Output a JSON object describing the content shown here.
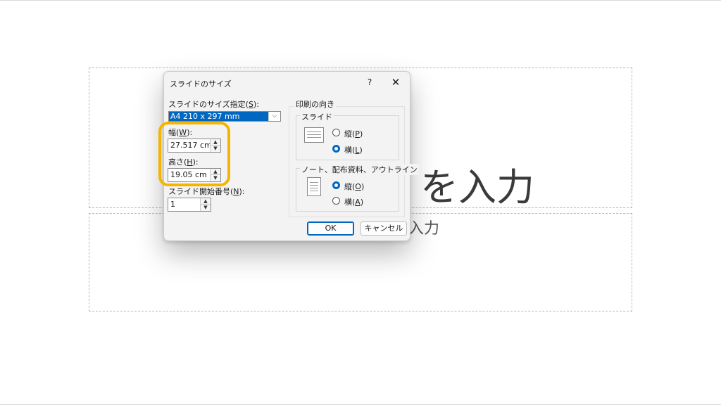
{
  "slide": {
    "title_placeholder": "を入力",
    "subtitle_placeholder": "入力"
  },
  "dialog": {
    "title": "スライドのサイズ",
    "help": "?",
    "close": "✕",
    "size_label": "スライドのサイズ指定(S):",
    "size_label_main": "スライドのサイズ指定(",
    "size_label_key": "S",
    "size_label_end": "):",
    "size_value": "A4 210 x 297 mm",
    "width_label_main": "幅(",
    "width_label_key": "W",
    "width_label_end": "):",
    "width_value": "27.517 cm",
    "height_label_main": "高さ(",
    "height_label_key": "H",
    "height_label_end": "):",
    "height_value": "19.05 cm",
    "start_label_main": "スライド開始番号(",
    "start_label_key": "N",
    "start_label_end": "):",
    "start_value": "1",
    "orientation_group": "印刷の向き",
    "slide_group": "スライド",
    "slide_portrait_main": "縦(",
    "slide_portrait_key": "P",
    "slide_portrait_end": ")",
    "slide_landscape_main": "横(",
    "slide_landscape_key": "L",
    "slide_landscape_end": ")",
    "notes_group": "ノート、配布資料、アウトライン",
    "notes_portrait_main": "縦(",
    "notes_portrait_key": "O",
    "notes_portrait_end": ")",
    "notes_landscape_main": "横(",
    "notes_landscape_key": "A",
    "notes_landscape_end": ")",
    "ok": "OK",
    "cancel": "キャンセル",
    "spin_up": "▲",
    "spin_down": "▼",
    "dropdown_arrow": "⌵"
  },
  "colors": {
    "accent": "#0067c0",
    "highlight": "#f5b400"
  }
}
